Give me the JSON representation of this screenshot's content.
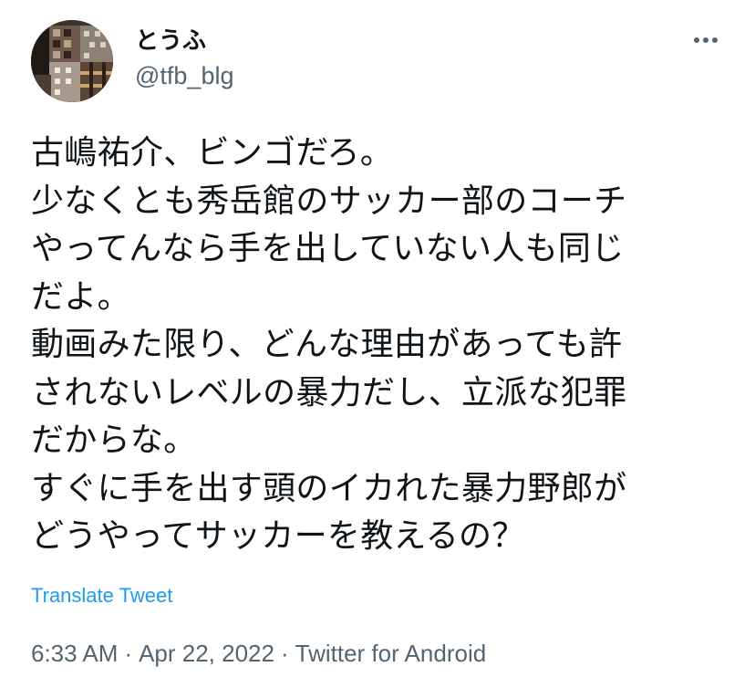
{
  "user": {
    "display_name": "とうふ",
    "handle": "@tfb_blg"
  },
  "tweet": {
    "lines": [
      "古嶋祐介、ビンゴだろ。",
      "少なくとも秀岳館のサッカー部のコーチ",
      "やってんなら手を出していない人も同じ",
      "だよ。",
      "動画みた限り、どんな理由があっても許",
      "されないレベルの暴力だし、立派な犯罪",
      "だからな。",
      "すぐに手を出す頭のイカれた暴力野郎が",
      "どうやってサッカーを教えるの？"
    ],
    "translate_label": "Translate Tweet",
    "time": "6:33 AM",
    "date": "Apr 22, 2022",
    "separator": "·",
    "source": "Twitter for Android"
  },
  "icons": {
    "more": "more-horizontal-icon",
    "avatar": "profile-avatar"
  },
  "colors": {
    "text": "#0f1419",
    "secondary": "#536471",
    "link": "#1d9bf0",
    "background": "#ffffff"
  }
}
